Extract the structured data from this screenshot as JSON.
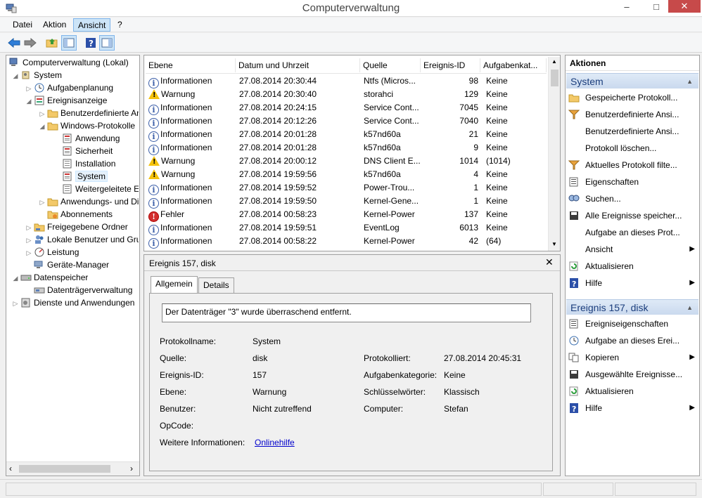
{
  "window": {
    "title": "Computerverwaltung",
    "minimize_label": "–",
    "maximize_label": "□",
    "close_label": "✕"
  },
  "menu": [
    "Datei",
    "Aktion",
    "Ansicht",
    "?"
  ],
  "menu_active": "Ansicht",
  "tree": {
    "root": "Computerverwaltung (Lokal)",
    "system": "System",
    "aufgabenplanung": "Aufgabenplanung",
    "ereignisanzeige": "Ereignisanzeige",
    "benutzerdefinierte": "Benutzerdefinierte Ansichten",
    "windows_protokolle": "Windows-Protokolle",
    "anwendung": "Anwendung",
    "sicherheit": "Sicherheit",
    "installation": "Installation",
    "system_log": "System",
    "weitergeleitete": "Weitergeleitete Ereignisse",
    "anwendungs_dienst": "Anwendungs- und Dienstprotokolle",
    "abonnements": "Abonnements",
    "freigegebene": "Freigegebene Ordner",
    "lokale_benutzer": "Lokale Benutzer und Gruppen",
    "leistung": "Leistung",
    "geraete_manager": "Geräte-Manager",
    "datenspeicher": "Datenspeicher",
    "datentraeger": "Datenträgerverwaltung",
    "dienste": "Dienste und Anwendungen"
  },
  "events": {
    "columns": [
      "Ebene",
      "Datum und Uhrzeit",
      "Quelle",
      "Ereignis-ID",
      "Aufgabenkat..."
    ],
    "rows": [
      {
        "level": "info",
        "ebene": "Informationen",
        "datum": "27.08.2014 20:30:44",
        "quelle": "Ntfs (Micros...",
        "id": "98",
        "kat": "Keine"
      },
      {
        "level": "warn",
        "ebene": "Warnung",
        "datum": "27.08.2014 20:30:40",
        "quelle": "storahci",
        "id": "129",
        "kat": "Keine"
      },
      {
        "level": "info",
        "ebene": "Informationen",
        "datum": "27.08.2014 20:24:15",
        "quelle": "Service Cont...",
        "id": "7045",
        "kat": "Keine"
      },
      {
        "level": "info",
        "ebene": "Informationen",
        "datum": "27.08.2014 20:12:26",
        "quelle": "Service Cont...",
        "id": "7040",
        "kat": "Keine"
      },
      {
        "level": "info",
        "ebene": "Informationen",
        "datum": "27.08.2014 20:01:28",
        "quelle": "k57nd60a",
        "id": "21",
        "kat": "Keine"
      },
      {
        "level": "info",
        "ebene": "Informationen",
        "datum": "27.08.2014 20:01:28",
        "quelle": "k57nd60a",
        "id": "9",
        "kat": "Keine"
      },
      {
        "level": "warn",
        "ebene": "Warnung",
        "datum": "27.08.2014 20:00:12",
        "quelle": "DNS Client E...",
        "id": "1014",
        "kat": "(1014)"
      },
      {
        "level": "warn",
        "ebene": "Warnung",
        "datum": "27.08.2014 19:59:56",
        "quelle": "k57nd60a",
        "id": "4",
        "kat": "Keine"
      },
      {
        "level": "info",
        "ebene": "Informationen",
        "datum": "27.08.2014 19:59:52",
        "quelle": "Power-Trou...",
        "id": "1",
        "kat": "Keine"
      },
      {
        "level": "info",
        "ebene": "Informationen",
        "datum": "27.08.2014 19:59:50",
        "quelle": "Kernel-Gene...",
        "id": "1",
        "kat": "Keine"
      },
      {
        "level": "err",
        "ebene": "Fehler",
        "datum": "27.08.2014 00:58:23",
        "quelle": "Kernel-Power",
        "id": "137",
        "kat": "Keine"
      },
      {
        "level": "info",
        "ebene": "Informationen",
        "datum": "27.08.2014 19:59:51",
        "quelle": "EventLog",
        "id": "6013",
        "kat": "Keine"
      },
      {
        "level": "info",
        "ebene": "Informationen",
        "datum": "27.08.2014 00:58:22",
        "quelle": "Kernel-Power",
        "id": "42",
        "kat": "(64)"
      }
    ]
  },
  "detail": {
    "title": "Ereignis 157, disk",
    "close": "✕",
    "tabs": [
      "Allgemein",
      "Details"
    ],
    "message": "Der Datenträger \"3\" wurde überraschend entfernt.",
    "labels": {
      "protokollname": "Protokollname:",
      "quelle": "Quelle:",
      "ereignis_id": "Ereignis-ID:",
      "ebene": "Ebene:",
      "benutzer": "Benutzer:",
      "opcode": "OpCode:",
      "weitere": "Weitere Informationen:",
      "protokolliert": "Protokolliert:",
      "aufgabenkategorie": "Aufgabenkategorie:",
      "schluesselwoerter": "Schlüsselwörter:",
      "computer": "Computer:"
    },
    "values": {
      "protokollname": "System",
      "quelle": "disk",
      "ereignis_id": "157",
      "ebene": "Warnung",
      "benutzer": "Nicht zutreffend",
      "weitere_link": "Onlinehilfe",
      "protokolliert": "27.08.2014 20:45:31",
      "aufgabenkategorie": "Keine",
      "schluesselwoerter": "Klassisch",
      "computer": "Stefan"
    }
  },
  "actions": {
    "header": "Aktionen",
    "group1": {
      "title": "System",
      "items": [
        {
          "label": "Gespeicherte Protokoll...",
          "icon": "folder-open-icon"
        },
        {
          "label": "Benutzerdefinierte Ansi...",
          "icon": "filter-icon"
        },
        {
          "label": "Benutzerdefinierte Ansi...",
          "icon": ""
        },
        {
          "label": "Protokoll löschen...",
          "icon": ""
        },
        {
          "label": "Aktuelles Protokoll filte...",
          "icon": "filter-icon"
        },
        {
          "label": "Eigenschaften",
          "icon": "properties-icon"
        },
        {
          "label": "Suchen...",
          "icon": "find-icon"
        },
        {
          "label": "Alle Ereignisse speicher...",
          "icon": "save-icon"
        },
        {
          "label": "Aufgabe an dieses Prot...",
          "icon": ""
        },
        {
          "label": "Ansicht",
          "icon": "",
          "submenu": true
        },
        {
          "label": "Aktualisieren",
          "icon": "refresh-icon"
        },
        {
          "label": "Hilfe",
          "icon": "help-icon",
          "submenu": true
        }
      ]
    },
    "group2": {
      "title": "Ereignis 157, disk",
      "items": [
        {
          "label": "Ereigniseigenschaften",
          "icon": "properties-icon"
        },
        {
          "label": "Aufgabe an dieses Erei...",
          "icon": "task-icon"
        },
        {
          "label": "Kopieren",
          "icon": "copy-icon",
          "submenu": true
        },
        {
          "label": "Ausgewählte Ereignisse...",
          "icon": "save-icon"
        },
        {
          "label": "Aktualisieren",
          "icon": "refresh-icon"
        },
        {
          "label": "Hilfe",
          "icon": "help-icon",
          "submenu": true
        }
      ]
    }
  }
}
